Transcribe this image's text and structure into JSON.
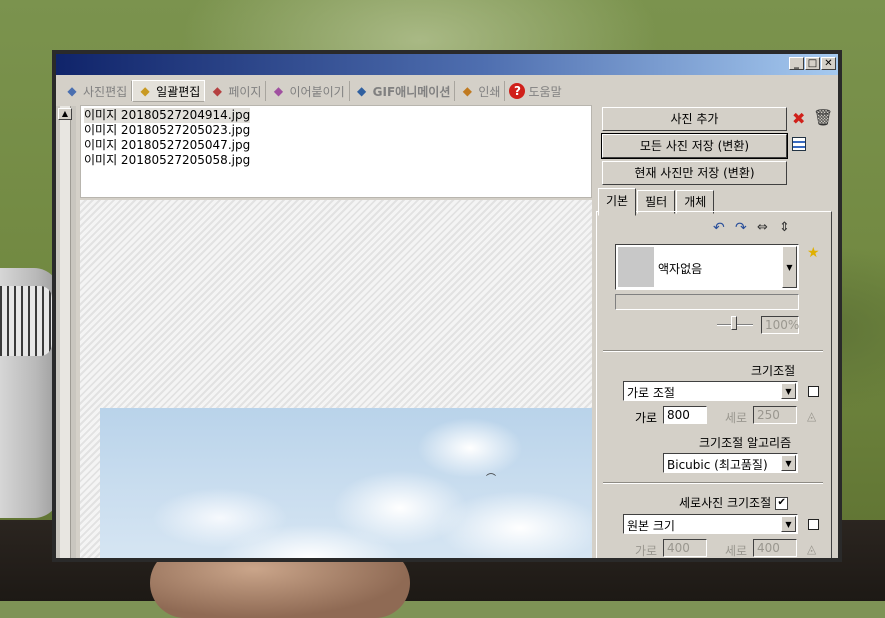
{
  "window": {
    "controls": {
      "minimize": "_",
      "maximize": "□",
      "close": "✕"
    }
  },
  "tabs": [
    {
      "label": "사진편집",
      "icon": "photo-edit-icon"
    },
    {
      "label": "일괄편집",
      "icon": "batch-edit-icon"
    },
    {
      "label": "페이지",
      "icon": "page-icon"
    },
    {
      "label": "이어붙이기",
      "icon": "stitch-icon"
    },
    {
      "label": "GIF애니메이션",
      "icon": "gif-icon"
    },
    {
      "label": "인쇄",
      "icon": "print-icon"
    },
    {
      "label": "도움말",
      "icon": "help-icon"
    }
  ],
  "files": [
    "이미지 20180527204914.jpg",
    "이미지 20180527205023.jpg",
    "이미지 20180527205047.jpg",
    "이미지 20180527205058.jpg"
  ],
  "actions": {
    "add_photo": "사진 추가",
    "save_all": "모든 사진 저장 (변환)",
    "save_current": "현재 사진만 저장 (변환)"
  },
  "panel_tabs": [
    "기본",
    "필터",
    "개체"
  ],
  "frame": {
    "selected": "액자없음"
  },
  "opacity": {
    "value": "100%"
  },
  "resize": {
    "title": "크기조절",
    "mode": "가로 조절",
    "width_label": "가로",
    "width_value": "800",
    "height_label": "세로",
    "height_value": "250",
    "algorithm_label": "크기조절 알고리즘",
    "algorithm": "Bicubic (최고품질)"
  },
  "portrait": {
    "title": "세로사진 크기조절",
    "checked_mark": "✔",
    "mode": "원본 크기",
    "width_label": "가로",
    "width_value": "400",
    "height_label": "세로",
    "height_value": "400"
  },
  "colors": {
    "titlebar_start": "#10246a",
    "titlebar_end": "#a6caf0",
    "face": "#d4d0c8",
    "delete_red": "#d0201a"
  }
}
